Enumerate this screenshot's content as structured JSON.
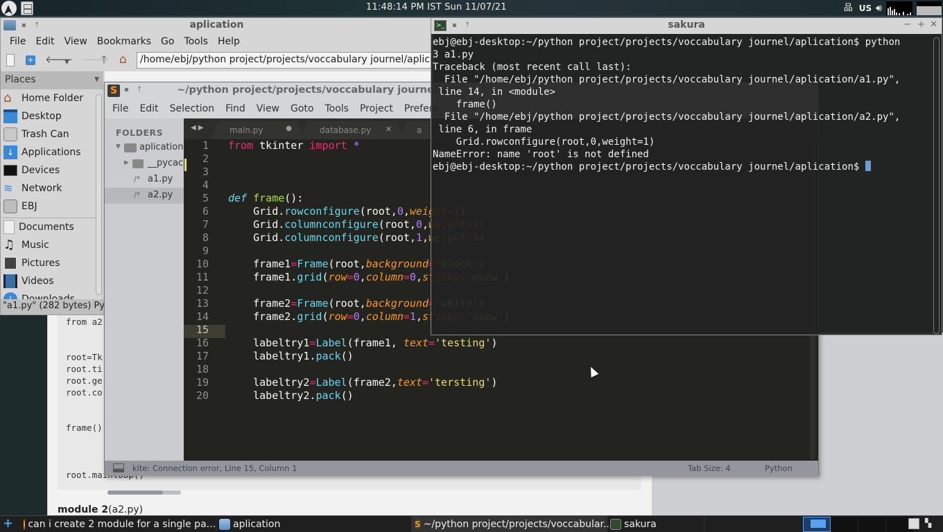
{
  "top_panel": {
    "clock": "11:48:14 PM IST  Sun 11/07/21",
    "keyboard_layout": "US",
    "icons": [
      "distro-logo-icon",
      "file-manager-launcher-icon",
      "network-icon",
      "volume-icon",
      "cpu-graph-icon",
      "memory-graph-icon"
    ]
  },
  "file_manager": {
    "title": "aplication",
    "menu": [
      "File",
      "Edit",
      "View",
      "Bookmarks",
      "Go",
      "Tools",
      "Help"
    ],
    "address": "/home/ebj/python project/projects/voccabulary journel/aplication",
    "places_label": "Places",
    "places": [
      {
        "label": "Home Folder",
        "icon": "home-icon"
      },
      {
        "label": "Desktop",
        "icon": "desktop-icon"
      },
      {
        "label": "Trash Can",
        "icon": "trash-icon"
      },
      {
        "label": "Applications",
        "icon": "applications-icon"
      },
      {
        "label": "Devices",
        "icon": "monitor-icon"
      },
      {
        "label": "Network",
        "icon": "wifi-icon"
      },
      {
        "label": "EBJ",
        "icon": "drive-icon"
      },
      {
        "label": "Documents",
        "icon": "document-icon"
      },
      {
        "label": "Music",
        "icon": "music-icon"
      },
      {
        "label": "Pictures",
        "icon": "pictures-icon"
      },
      {
        "label": "Videos",
        "icon": "video-icon"
      },
      {
        "label": "Downloads",
        "icon": "download-icon"
      }
    ],
    "status": "\"a1.py\" (282 bytes) Py"
  },
  "browser_page": {
    "code_lines": [
      "from a2",
      "root=Tk",
      "root.ti",
      "root.ge",
      "root.co",
      "frame()",
      "root.mainloop()"
    ],
    "module_title_bold": "module 2",
    "module_title_rest": "(a2.py)"
  },
  "sublime": {
    "title": "~/python project/projects/voccabulary journel/a",
    "menu": [
      "File",
      "Edit",
      "Selection",
      "Find",
      "View",
      "Goto",
      "Tools",
      "Project",
      "Prefere"
    ],
    "sidebar_header": "FOLDERS",
    "tree": [
      {
        "label": "aplication",
        "type": "folder-open"
      },
      {
        "label": "__pycach",
        "type": "folder"
      },
      {
        "label": "a1.py",
        "type": "file"
      },
      {
        "label": "a2.py",
        "type": "file",
        "selected": true
      }
    ],
    "tabs": [
      {
        "label": "main.py",
        "modified": true
      },
      {
        "label": "database.py",
        "modified": false
      },
      {
        "label": "a",
        "modified": false
      }
    ],
    "line_numbers": [
      "1",
      "2",
      "3",
      "4",
      "5",
      "6",
      "7",
      "8",
      "9",
      "10",
      "11",
      "12",
      "13",
      "14",
      "15",
      "16",
      "17",
      "18",
      "19",
      "20"
    ],
    "current_line": 15,
    "status": {
      "message": "kite: Connection error, Line 15, Column 1",
      "tab_size": "Tab Size: 4",
      "syntax": "Python"
    }
  },
  "terminal": {
    "title": "sakura",
    "lines": [
      "ebj@ebj-desktop:~/python project/projects/voccabulary journel/aplication$ python",
      "3 a1.py",
      "Traceback (most recent call last):",
      "  File \"/home/ebj/python project/projects/voccabulary journel/aplication/a1.py\",",
      " line 14, in <module>",
      "    frame()",
      "  File \"/home/ebj/python project/projects/voccabulary journel/aplication/a2.py\",",
      " line 6, in frame",
      "    Grid.rowconfigure(root,0,weight=1)",
      "NameError: name 'root' is not defined"
    ],
    "prompt": "ebj@ebj-desktop:~/python project/projects/voccabulary journel/aplication$ "
  },
  "taskbar": {
    "tasks": [
      {
        "label": "can i create 2 module for a single pa...",
        "icon": "firefox-icon"
      },
      {
        "label": "aplication",
        "icon": "folder-icon"
      },
      {
        "label": "~/python project/projects/voccabular...",
        "icon": "sublime-icon"
      },
      {
        "label": "sakura",
        "icon": "terminal-icon"
      }
    ]
  }
}
